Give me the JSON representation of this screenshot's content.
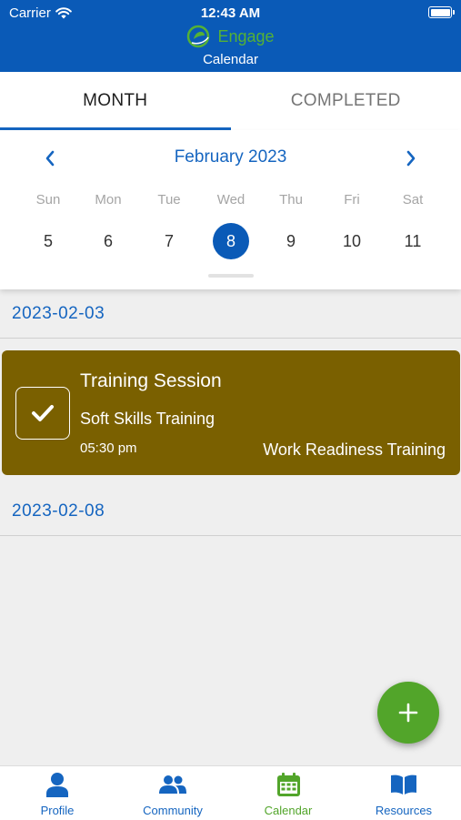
{
  "status_bar": {
    "carrier": "Carrier",
    "time": "12:43 AM"
  },
  "header": {
    "brand": "Engage",
    "title": "Calendar"
  },
  "tabs": [
    {
      "label": "MONTH",
      "active": true
    },
    {
      "label": "COMPLETED",
      "active": false
    }
  ],
  "calendar": {
    "month_label": "February 2023",
    "weekdays": [
      "Sun",
      "Mon",
      "Tue",
      "Wed",
      "Thu",
      "Fri",
      "Sat"
    ],
    "days": [
      "5",
      "6",
      "7",
      "8",
      "9",
      "10",
      "11"
    ],
    "selected_day": "8"
  },
  "agenda": {
    "sections": [
      {
        "date": "2023-02-03",
        "events": [
          {
            "title": "Training Session",
            "subtitle": "Soft Skills Training",
            "time": "05:30 pm",
            "category": "Work Readiness Training",
            "completed": true,
            "color": "#7a6000"
          }
        ]
      },
      {
        "date": "2023-02-08",
        "events": []
      }
    ]
  },
  "fab": {
    "icon": "plus-icon",
    "color": "#52a52a"
  },
  "bottom_nav": [
    {
      "label": "Profile",
      "icon": "person-icon",
      "active": false
    },
    {
      "label": "Community",
      "icon": "community-icon",
      "active": false
    },
    {
      "label": "Calendar",
      "icon": "calendar-icon",
      "active": true
    },
    {
      "label": "Resources",
      "icon": "book-icon",
      "active": false
    }
  ],
  "colors": {
    "primary": "#0a5ab7",
    "accent": "#52a52a",
    "link": "#1565c0"
  }
}
